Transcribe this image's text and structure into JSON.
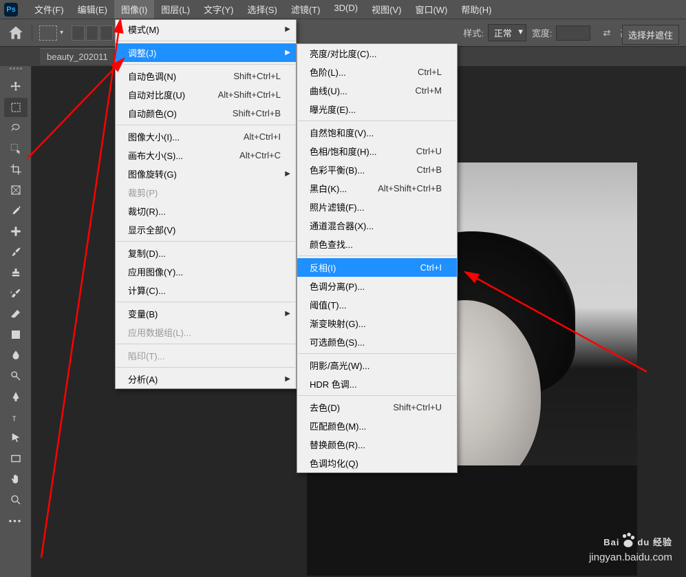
{
  "app": {
    "logo": "Ps"
  },
  "menubar": [
    "文件(F)",
    "编辑(E)",
    "图像(I)",
    "图层(L)",
    "文字(Y)",
    "选择(S)",
    "滤镜(T)",
    "3D(D)",
    "视图(V)",
    "窗口(W)",
    "帮助(H)"
  ],
  "menubar_active": 2,
  "options": {
    "style_label": "样式:",
    "style_value": "正常",
    "width_label": "宽度:",
    "height_label": "高度:",
    "button": "选择并遮住"
  },
  "doc_tab": "beauty_202011",
  "menu1": [
    {
      "t": "item",
      "label": "模式(M)",
      "sub": true
    },
    {
      "t": "sep"
    },
    {
      "t": "item",
      "label": "调整(J)",
      "sub": true,
      "hl": true
    },
    {
      "t": "sep"
    },
    {
      "t": "item",
      "label": "自动色调(N)",
      "sc": "Shift+Ctrl+L"
    },
    {
      "t": "item",
      "label": "自动对比度(U)",
      "sc": "Alt+Shift+Ctrl+L"
    },
    {
      "t": "item",
      "label": "自动颜色(O)",
      "sc": "Shift+Ctrl+B"
    },
    {
      "t": "sep"
    },
    {
      "t": "item",
      "label": "图像大小(I)...",
      "sc": "Alt+Ctrl+I"
    },
    {
      "t": "item",
      "label": "画布大小(S)...",
      "sc": "Alt+Ctrl+C"
    },
    {
      "t": "item",
      "label": "图像旋转(G)",
      "sub": true
    },
    {
      "t": "item",
      "label": "裁剪(P)",
      "dis": true
    },
    {
      "t": "item",
      "label": "裁切(R)..."
    },
    {
      "t": "item",
      "label": "显示全部(V)"
    },
    {
      "t": "sep"
    },
    {
      "t": "item",
      "label": "复制(D)..."
    },
    {
      "t": "item",
      "label": "应用图像(Y)..."
    },
    {
      "t": "item",
      "label": "计算(C)..."
    },
    {
      "t": "sep"
    },
    {
      "t": "item",
      "label": "变量(B)",
      "sub": true
    },
    {
      "t": "item",
      "label": "应用数据组(L)...",
      "dis": true
    },
    {
      "t": "sep"
    },
    {
      "t": "item",
      "label": "陷印(T)...",
      "dis": true
    },
    {
      "t": "sep"
    },
    {
      "t": "item",
      "label": "分析(A)",
      "sub": true
    }
  ],
  "menu2": [
    {
      "t": "item",
      "label": "亮度/对比度(C)..."
    },
    {
      "t": "item",
      "label": "色阶(L)...",
      "sc": "Ctrl+L"
    },
    {
      "t": "item",
      "label": "曲线(U)...",
      "sc": "Ctrl+M"
    },
    {
      "t": "item",
      "label": "曝光度(E)..."
    },
    {
      "t": "sep"
    },
    {
      "t": "item",
      "label": "自然饱和度(V)..."
    },
    {
      "t": "item",
      "label": "色相/饱和度(H)...",
      "sc": "Ctrl+U"
    },
    {
      "t": "item",
      "label": "色彩平衡(B)...",
      "sc": "Ctrl+B"
    },
    {
      "t": "item",
      "label": "黑白(K)...",
      "sc": "Alt+Shift+Ctrl+B"
    },
    {
      "t": "item",
      "label": "照片滤镜(F)..."
    },
    {
      "t": "item",
      "label": "通道混合器(X)..."
    },
    {
      "t": "item",
      "label": "颜色查找..."
    },
    {
      "t": "sep"
    },
    {
      "t": "item",
      "label": "反相(I)",
      "sc": "Ctrl+I",
      "hl": true
    },
    {
      "t": "item",
      "label": "色调分离(P)..."
    },
    {
      "t": "item",
      "label": "阈值(T)..."
    },
    {
      "t": "item",
      "label": "渐变映射(G)..."
    },
    {
      "t": "item",
      "label": "可选颜色(S)..."
    },
    {
      "t": "sep"
    },
    {
      "t": "item",
      "label": "阴影/高光(W)..."
    },
    {
      "t": "item",
      "label": "HDR 色调..."
    },
    {
      "t": "sep"
    },
    {
      "t": "item",
      "label": "去色(D)",
      "sc": "Shift+Ctrl+U"
    },
    {
      "t": "item",
      "label": "匹配颜色(M)..."
    },
    {
      "t": "item",
      "label": "替换颜色(R)..."
    },
    {
      "t": "item",
      "label": "色调均化(Q)"
    }
  ],
  "watermark": {
    "line1": "Baidu 经验",
    "line2": "jingyan.baidu.com"
  }
}
